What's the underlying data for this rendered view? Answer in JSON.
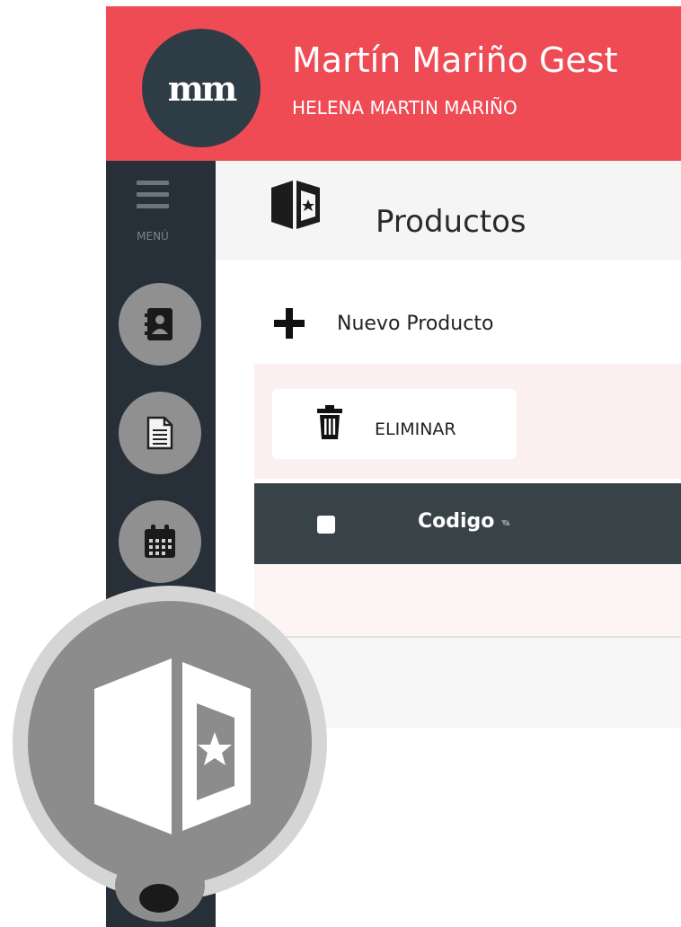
{
  "header": {
    "logo_text": "mm",
    "app_title": "Martín Mariño Gest",
    "user_name": "HELENA MARTIN MARIÑO"
  },
  "sidebar": {
    "menu_label": "MENÚ",
    "items": [
      {
        "icon": "contacts-book-icon"
      },
      {
        "icon": "document-icon"
      },
      {
        "icon": "calendar-icon"
      },
      {
        "icon": "products-box-icon"
      },
      {
        "icon": "chat-icon"
      }
    ]
  },
  "page": {
    "title": "Productos",
    "title_icon": "products-box-icon"
  },
  "toolbar": {
    "new_label": "Nuevo Producto",
    "delete_label": "ELIMINAR"
  },
  "table": {
    "columns": [
      "Codigo"
    ],
    "select_all_checked": false
  },
  "colors": {
    "header_bg": "#ef4b55",
    "sidebar_bg": "#273038",
    "table_head_bg": "#384348"
  }
}
